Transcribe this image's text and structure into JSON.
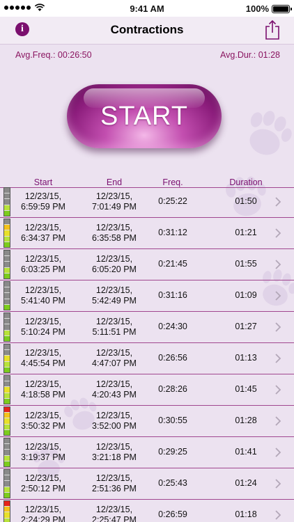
{
  "status": {
    "time": "9:41 AM",
    "battery": "100%"
  },
  "nav": {
    "title": "Contractions",
    "info_symbol": "i"
  },
  "averages": {
    "freq_label": "Avg.Freq.:",
    "freq_value": "00:26:50",
    "dur_label": "Avg.Dur.:",
    "dur_value": "01:28"
  },
  "start_button": {
    "label": "START"
  },
  "table": {
    "headers": {
      "start": "Start",
      "end": "End",
      "freq": "Freq.",
      "duration": "Duration"
    },
    "rows": [
      {
        "start_date": "12/23/15,",
        "start_time": "6:59:59 PM",
        "end_date": "12/23/15,",
        "end_time": "7:01:49 PM",
        "freq": "0:25:22",
        "duration": "01:50",
        "level": [
          "#8a8a8a",
          "#8a8a8a",
          "#8a8a8a",
          "#b8e23a",
          "#7ccc1d"
        ]
      },
      {
        "start_date": "12/23/15,",
        "start_time": "6:34:37 PM",
        "end_date": "12/23/15,",
        "end_time": "6:35:58 PM",
        "freq": "0:31:12",
        "duration": "01:21",
        "level": [
          "#8a8a8a",
          "#f4c21b",
          "#e8e02a",
          "#b8e23a",
          "#7ccc1d"
        ]
      },
      {
        "start_date": "12/23/15,",
        "start_time": "6:03:25 PM",
        "end_date": "12/23/15,",
        "end_time": "6:05:20 PM",
        "freq": "0:21:45",
        "duration": "01:55",
        "level": [
          "#8a8a8a",
          "#8a8a8a",
          "#8a8a8a",
          "#b8e23a",
          "#7ccc1d"
        ]
      },
      {
        "start_date": "12/23/15,",
        "start_time": "5:41:40 PM",
        "end_date": "12/23/15,",
        "end_time": "5:42:49 PM",
        "freq": "0:31:16",
        "duration": "01:09",
        "level": [
          "#8a8a8a",
          "#8a8a8a",
          "#8a8a8a",
          "#8a8a8a",
          "#7ccc1d"
        ]
      },
      {
        "start_date": "12/23/15,",
        "start_time": "5:10:24 PM",
        "end_date": "12/23/15,",
        "end_time": "5:11:51 PM",
        "freq": "0:24:30",
        "duration": "01:27",
        "level": [
          "#8a8a8a",
          "#8a8a8a",
          "#8a8a8a",
          "#b8e23a",
          "#7ccc1d"
        ]
      },
      {
        "start_date": "12/23/15,",
        "start_time": "4:45:54 PM",
        "end_date": "12/23/15,",
        "end_time": "4:47:07 PM",
        "freq": "0:26:56",
        "duration": "01:13",
        "level": [
          "#8a8a8a",
          "#8a8a8a",
          "#e8e02a",
          "#b8e23a",
          "#7ccc1d"
        ]
      },
      {
        "start_date": "12/23/15,",
        "start_time": "4:18:58 PM",
        "end_date": "12/23/15,",
        "end_time": "4:20:43 PM",
        "freq": "0:28:26",
        "duration": "01:45",
        "level": [
          "#8a8a8a",
          "#8a8a8a",
          "#e8e02a",
          "#b8e23a",
          "#7ccc1d"
        ]
      },
      {
        "start_date": "12/23/15,",
        "start_time": "3:50:32 PM",
        "end_date": "12/23/15,",
        "end_time": "3:52:00 PM",
        "freq": "0:30:55",
        "duration": "01:28",
        "level": [
          "#e5231b",
          "#f4c21b",
          "#e8e02a",
          "#b8e23a",
          "#7ccc1d"
        ]
      },
      {
        "start_date": "12/23/15,",
        "start_time": "3:19:37 PM",
        "end_date": "12/23/15,",
        "end_time": "3:21:18 PM",
        "freq": "0:29:25",
        "duration": "01:41",
        "level": [
          "#8a8a8a",
          "#8a8a8a",
          "#8a8a8a",
          "#b8e23a",
          "#7ccc1d"
        ]
      },
      {
        "start_date": "12/23/15,",
        "start_time": "2:50:12 PM",
        "end_date": "12/23/15,",
        "end_time": "2:51:36 PM",
        "freq": "0:25:43",
        "duration": "01:24",
        "level": [
          "#8a8a8a",
          "#8a8a8a",
          "#8a8a8a",
          "#b8e23a",
          "#7ccc1d"
        ]
      },
      {
        "start_date": "12/23/15,",
        "start_time": "2:24:29 PM",
        "end_date": "12/23/15,",
        "end_time": "2:25:47 PM",
        "freq": "0:26:59",
        "duration": "01:18",
        "level": [
          "#e5231b",
          "#f4c21b",
          "#e8e02a",
          "#b8e23a",
          "#7ccc1d"
        ]
      }
    ]
  },
  "colors": {
    "accent": "#7b0f6e",
    "divider": "#a0468f",
    "background": "#ece2f0"
  },
  "icons": {
    "info": "info-icon",
    "share": "share-icon",
    "chevron": "chevron-right-icon",
    "wifi": "wifi-icon",
    "battery": "battery-icon"
  }
}
